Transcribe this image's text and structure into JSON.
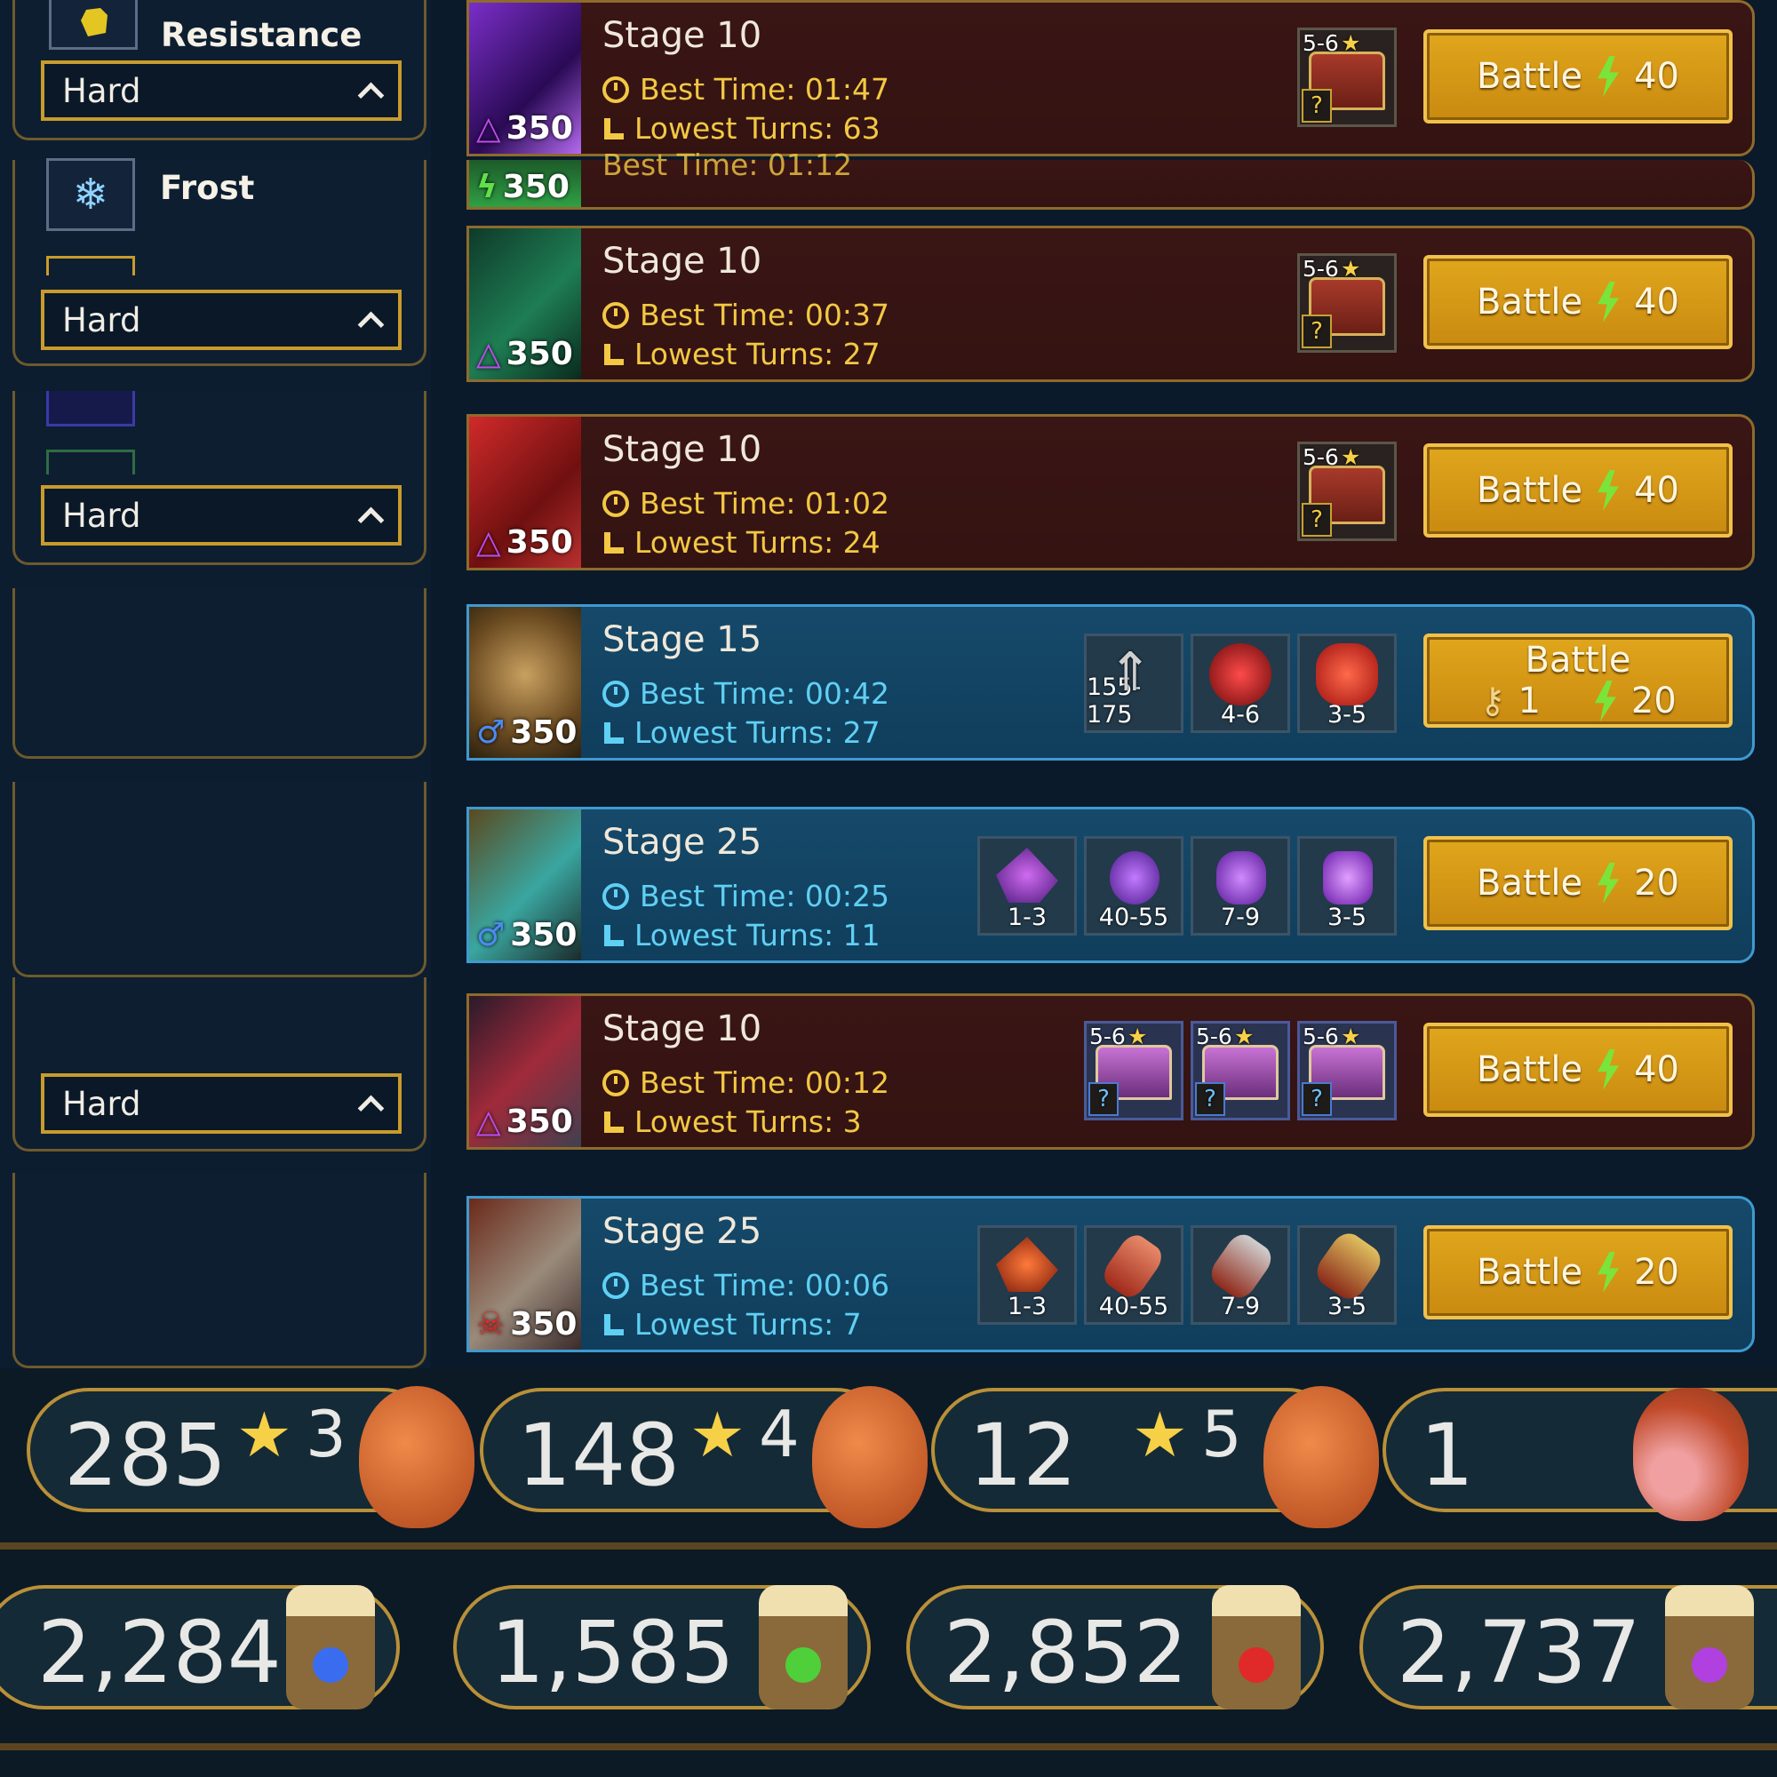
{
  "affinities": [
    {
      "name": "Resistance",
      "difficulty": "Hard"
    },
    {
      "name": "Frost",
      "difficulty": "Hard"
    },
    {
      "difficulty": "Hard"
    },
    {
      "difficulty": "Hard"
    }
  ],
  "rows": [
    {
      "stage": "Stage 10",
      "best": "Best Time: 01:47",
      "turns": "Lowest Turns: 63",
      "power": "350",
      "btn": "Battle",
      "cost": "40",
      "rewardTag": "5-6"
    },
    {
      "stage": "Stage 10",
      "best": "Best Time: 00:37",
      "turns": "Lowest Turns: 27",
      "power": "350",
      "btn": "Battle",
      "cost": "40",
      "rewardTag": "5-6"
    },
    {
      "stage": "Stage 10",
      "best": "Best Time: 01:02",
      "turns": "Lowest Turns: 24",
      "power": "350",
      "btn": "Battle",
      "cost": "40",
      "rewardTag": "5-6"
    },
    {
      "stage": "Stage 15",
      "best": "Best Time: 00:42",
      "turns": "Lowest Turns: 27",
      "power": "350",
      "btn": "Battle",
      "keys": "1",
      "cost": "20",
      "rewards": [
        "155-175",
        "4-6",
        "3-5"
      ]
    },
    {
      "stage": "Stage 25",
      "best": "Best Time: 00:25",
      "turns": "Lowest Turns: 11",
      "power": "350",
      "btn": "Battle",
      "cost": "20",
      "rewards": [
        "1-3",
        "40-55",
        "7-9",
        "3-5"
      ]
    },
    {
      "stage": "Stage 10",
      "best": "Best Time: 00:12",
      "turns": "Lowest Turns: 3",
      "power": "350",
      "btn": "Battle",
      "cost": "40",
      "rewards": [
        "5-6",
        "5-6",
        "5-6"
      ]
    },
    {
      "stage": "Stage 25",
      "best": "Best Time: 00:06",
      "turns": "Lowest Turns: 7",
      "power": "350",
      "btn": "Battle",
      "cost": "20",
      "rewards": [
        "1-3",
        "40-55",
        "7-9",
        "3-5"
      ]
    }
  ],
  "partial_row": {
    "power": "350",
    "best": "Best Time: 01:12"
  },
  "food": [
    {
      "count": "285",
      "stars": "3"
    },
    {
      "count": "148",
      "stars": "4"
    },
    {
      "count": "12",
      "stars": "5"
    },
    {
      "count": "1"
    }
  ],
  "potions": [
    {
      "count": "2,284",
      "color": "#3a6cf0"
    },
    {
      "count": "1,585",
      "color": "#4fcf3a"
    },
    {
      "count": "2,852",
      "color": "#e02a2a"
    },
    {
      "count": "2,737",
      "color": "#b040e0"
    }
  ],
  "colors": {
    "accent": "#e0a61c",
    "bolt": "#7be43a"
  }
}
